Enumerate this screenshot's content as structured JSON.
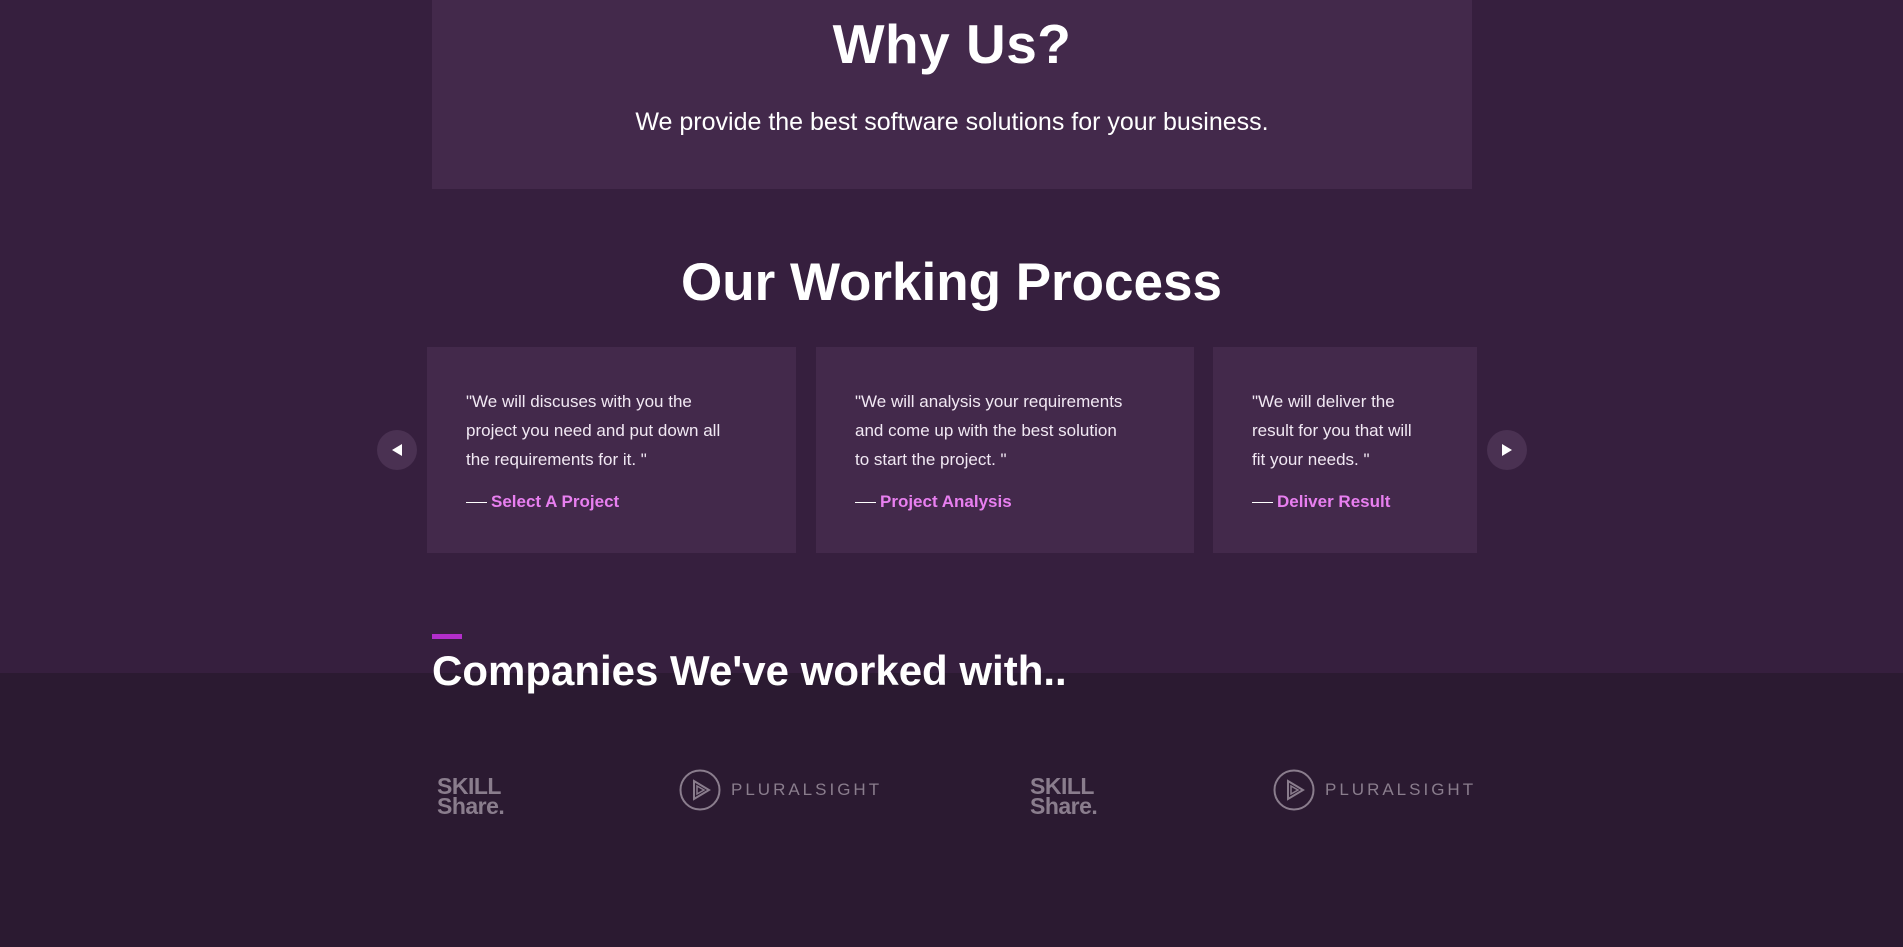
{
  "why_us": {
    "title": "Why Us?",
    "subtitle": "We provide the best software solutions for your business."
  },
  "process": {
    "title": "Our Working Process",
    "cards": [
      {
        "quote_lines": [
          "\"We will discuses with you the",
          "project you need and put down all",
          "the requirements for it. \""
        ],
        "step": "Select A Project"
      },
      {
        "quote_lines": [
          "\"We will analysis your requirements",
          "and come up with the best solution",
          "to start the project. \""
        ],
        "step": "Project Analysis"
      },
      {
        "quote_lines": [
          "\"We will deliver the",
          "result for you that will",
          "fit your needs. \""
        ],
        "step": "Deliver Result"
      }
    ],
    "prev_icon": "arrow-left-icon",
    "next_icon": "arrow-right-icon"
  },
  "companies": {
    "title": "Companies We've worked with..",
    "logos": [
      {
        "name": "skillshare",
        "line1": "SKILL",
        "line2": "Share."
      },
      {
        "name": "pluralsight",
        "text": "PLURALSIGHT"
      },
      {
        "name": "skillshare",
        "line1": "SKILL",
        "line2": "Share."
      },
      {
        "name": "pluralsight",
        "text": "PLURALSIGHT"
      }
    ]
  },
  "colors": {
    "background": "#361f3e",
    "background_dark": "#2b1a31",
    "card": "#43294b",
    "accent": "#b32ecb",
    "step_label": "#e87ff0",
    "logo_gray": "#8a7d8d"
  }
}
